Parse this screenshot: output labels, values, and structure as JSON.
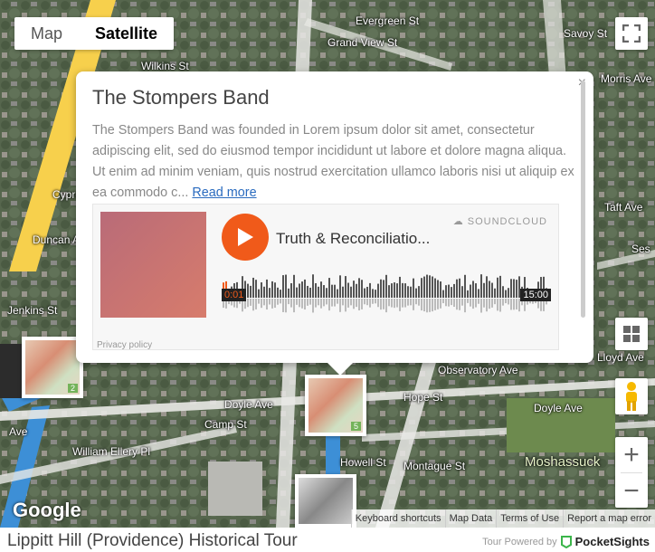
{
  "map_type": {
    "map_label": "Map",
    "satellite_label": "Satellite"
  },
  "streets": [
    "Evergreen St",
    "Grand View St",
    "Savoy St",
    "Wilkins St",
    "Morris Ave",
    "Cypress",
    "Duncan Ave",
    "Jenkins St",
    "Taft Ave",
    "Ses",
    "Lloyd Ave",
    "Observatory Ave",
    "Doyle Ave",
    "Doyle Ave",
    "Camp St",
    "Hope St",
    "William Ellery Pl",
    "Howell St",
    "Montague St",
    "Moshassuck",
    "Ave"
  ],
  "markers": [
    {
      "badge": "2"
    },
    {
      "badge": "5"
    }
  ],
  "popup": {
    "title": "The Stompers Band",
    "description": "The Stompers Band was founded in Lorem ipsum dolor sit amet, consectetur adipiscing elit, sed do eiusmod tempor incididunt ut labore et dolore magna aliqua. Ut enim ad minim veniam, quis nostrud exercitation ullamco laboris nisi ut aliquip ex ea commodo c...",
    "read_more": "Read more",
    "close_glyph": "×",
    "soundcloud": {
      "brand": "SOUNDCLOUD",
      "track_title": "Truth & Reconciliatio...",
      "time_current": "0:01",
      "time_total": "15:00",
      "privacy": "Privacy policy"
    }
  },
  "google_logo": "Google",
  "attribution": [
    "Keyboard shortcuts",
    "Map Data",
    "Terms of Use",
    "Report a map error"
  ],
  "footer": {
    "tour_title": "Lippitt Hill (Providence) Historical Tour",
    "powered_by": "Tour Powered by",
    "brand": "PocketSights"
  },
  "colors": {
    "accent": "#f05a1a",
    "link": "#2a6bbf",
    "road_yellow": "#f7d04c",
    "road_blue": "#3d8fd6"
  }
}
